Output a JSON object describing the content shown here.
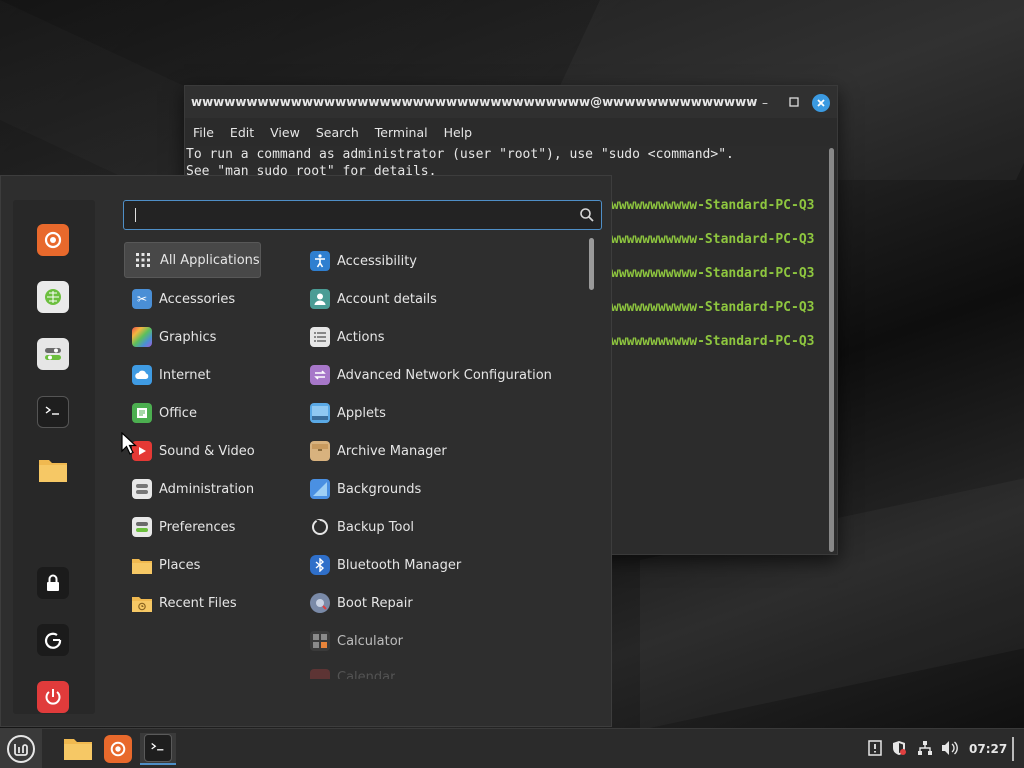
{
  "terminal": {
    "title": "wwwwwwwwwwwwwwwwwwwwwwwwwwwwwwwwwwww@wwwwwwwwwwwwwwwwwwwww...",
    "menus": [
      "File",
      "Edit",
      "View",
      "Search",
      "Terminal",
      "Help"
    ],
    "lines": [
      "To run a command as administrator (user \"root\"), use \"sudo <command>\".",
      "See \"man sudo_root\" for details."
    ],
    "prompts": [
      "wwwwwwwwwww-Standard-PC-Q3",
      "wwwwwwwwwww-Standard-PC-Q3",
      "wwwwwwwwwww-Standard-PC-Q3",
      "wwwwwwwwwww-Standard-PC-Q3",
      "wwwwwwwwwww-Standard-PC-Q3"
    ]
  },
  "menu": {
    "search": {
      "value": ""
    },
    "categories": [
      {
        "label": "All Applications",
        "icon": "grid-icon"
      },
      {
        "label": "Accessories",
        "icon": "scissors-icon"
      },
      {
        "label": "Graphics",
        "icon": "palette-icon"
      },
      {
        "label": "Internet",
        "icon": "cloud-icon"
      },
      {
        "label": "Office",
        "icon": "document-icon"
      },
      {
        "label": "Sound & Video",
        "icon": "play-icon"
      },
      {
        "label": "Administration",
        "icon": "toggles-icon"
      },
      {
        "label": "Preferences",
        "icon": "switches-icon"
      },
      {
        "label": "Places",
        "icon": "folder-icon"
      },
      {
        "label": "Recent Files",
        "icon": "recent-folder-icon"
      }
    ],
    "apps": [
      {
        "label": "Accessibility",
        "icon": "accessibility-icon"
      },
      {
        "label": "Account details",
        "icon": "user-icon"
      },
      {
        "label": "Actions",
        "icon": "list-icon"
      },
      {
        "label": "Advanced Network Configuration",
        "icon": "network-icon"
      },
      {
        "label": "Applets",
        "icon": "applets-icon"
      },
      {
        "label": "Archive Manager",
        "icon": "archive-icon"
      },
      {
        "label": "Backgrounds",
        "icon": "image-icon"
      },
      {
        "label": "Backup Tool",
        "icon": "backup-icon"
      },
      {
        "label": "Bluetooth Manager",
        "icon": "bluetooth-icon"
      },
      {
        "label": "Boot Repair",
        "icon": "boot-repair-icon"
      },
      {
        "label": "Calculator",
        "icon": "calculator-icon"
      },
      {
        "label": "Calendar",
        "icon": "calendar-icon"
      }
    ],
    "favorites": [
      "firefox-icon",
      "software-manager-icon",
      "settings-icon",
      "terminal-icon",
      "files-icon",
      "lock-icon",
      "logout-icon",
      "power-icon"
    ]
  },
  "taskbar": {
    "clock": "07:27"
  },
  "colors": {
    "accent": "#4f8fc7",
    "prompt": "#8ec63f",
    "close_button": "#3b9ae1"
  }
}
